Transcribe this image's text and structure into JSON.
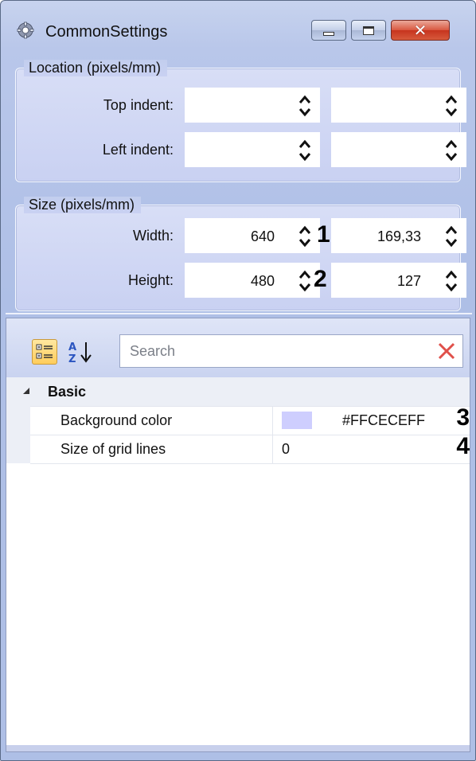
{
  "window": {
    "title": "CommonSettings",
    "close_glyph": "✕"
  },
  "location": {
    "legend": "Location (pixels/mm)",
    "top_label": "Top indent:",
    "left_label": "Left indent:",
    "top_px": "",
    "top_mm": "",
    "left_px": "",
    "left_mm": ""
  },
  "size": {
    "legend": "Size (pixels/mm)",
    "width_label": "Width:",
    "height_label": "Height:",
    "width_px": "640",
    "width_mm": "169,33",
    "height_px": "480",
    "height_mm": "127",
    "marker_width": "1",
    "marker_height": "2"
  },
  "toolbar": {
    "search_placeholder": "Search"
  },
  "grid": {
    "category": "Basic",
    "rows": [
      {
        "name": "Background color",
        "value": "#FFCECEFF",
        "swatch_color": "#cecefe",
        "marker": "3"
      },
      {
        "name": "Size of grid lines",
        "value": "0",
        "marker": "4"
      }
    ]
  },
  "icons": {
    "app": "gear-icon",
    "minimize": "minimize-icon",
    "maximize": "maximize-icon",
    "close": "close-icon",
    "spin": "spin-updown-icon",
    "categorized": "categorized-view-icon",
    "alphabetical": "sort-az-icon",
    "clear": "clear-search-icon"
  }
}
